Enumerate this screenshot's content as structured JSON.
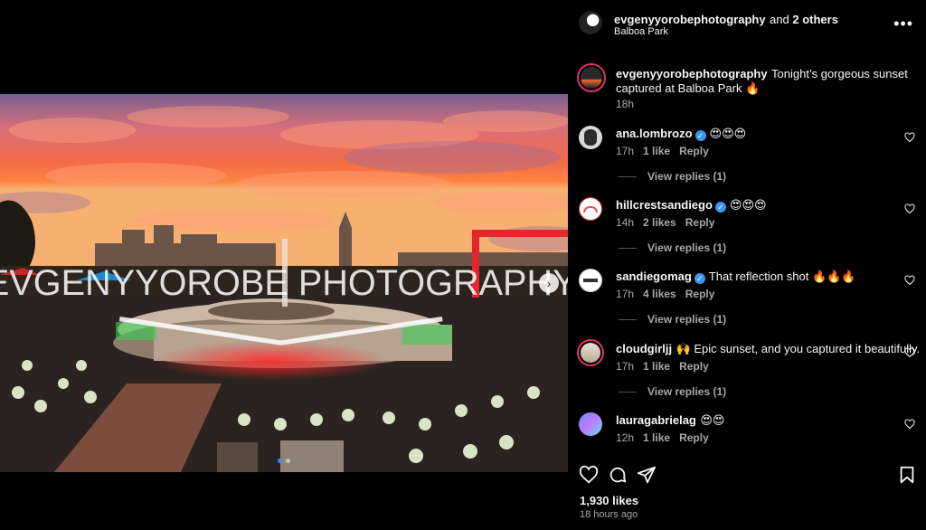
{
  "header": {
    "username": "evgenyyorobephotography",
    "and_others": "and 2 others",
    "location": "Balboa Park"
  },
  "caption": {
    "username": "evgenyyorobephotography",
    "text": "Tonight’s gorgeous sunset captured at Balboa Park 🔥",
    "time": "18h"
  },
  "comments": [
    {
      "username": "ana.lombrozo",
      "verified": true,
      "text": "😍😍😍",
      "time": "17h",
      "likes": "1 like",
      "reply": "Reply",
      "view_replies": "View replies (1)"
    },
    {
      "username": "hillcrestsandiego",
      "verified": true,
      "text": "😍😍😍",
      "time": "14h",
      "likes": "2 likes",
      "reply": "Reply",
      "view_replies": "View replies (1)"
    },
    {
      "username": "sandiegomag",
      "verified": true,
      "text": "That reflection shot 🔥🔥🔥",
      "time": "17h",
      "likes": "4 likes",
      "reply": "Reply",
      "view_replies": "View replies (1)"
    },
    {
      "username": "cloudgirljj",
      "verified": false,
      "text": "🙌 Epic sunset, and you captured it beautifully.",
      "time": "17h",
      "likes": "1 like",
      "reply": "Reply",
      "view_replies": "View replies (1)"
    },
    {
      "username": "lauragabrielag",
      "verified": false,
      "text": "😍😍",
      "time": "12h",
      "likes": "1 like",
      "reply": "Reply"
    }
  ],
  "likes_count": "1,930 likes",
  "post_time": "18 hours ago",
  "watermark_text": "EVGENYYOROBE PHOTOGRAPHY",
  "carousel": {
    "total": 2,
    "active": 1
  },
  "icons": {
    "more": "more-options-icon",
    "like": "heart-icon",
    "comment": "comment-icon",
    "share": "send-icon",
    "save": "bookmark-icon",
    "next": "chevron-right-icon"
  },
  "colors": {
    "accent": "#3897f0",
    "story_ring": "#e1306c",
    "panel_bg": "#000000"
  }
}
